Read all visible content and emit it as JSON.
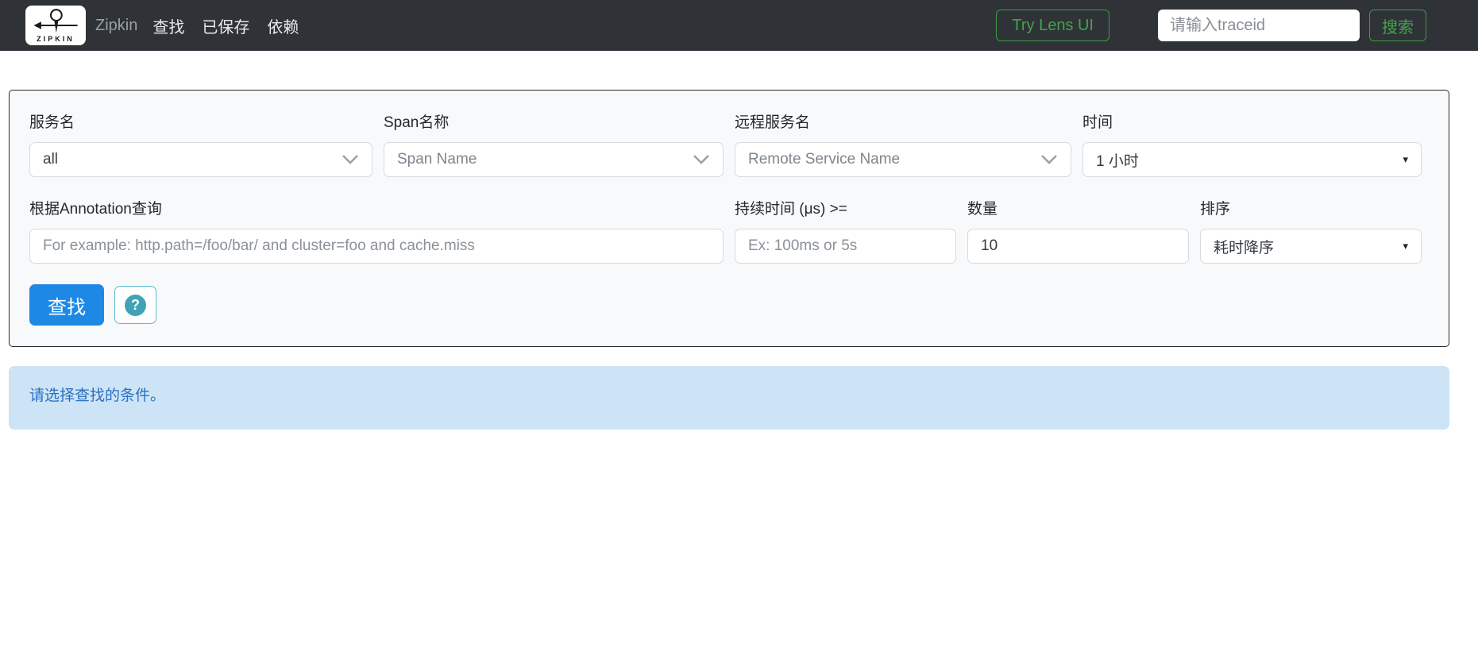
{
  "navbar": {
    "logo_text": "ZIPKIN",
    "brand": "Zipkin",
    "items": [
      {
        "label": "查找"
      },
      {
        "label": "已保存"
      },
      {
        "label": "依赖"
      }
    ],
    "try_lens_label": "Try Lens UI",
    "traceid_placeholder": "请输入traceid",
    "search_label": "搜索"
  },
  "form": {
    "service": {
      "label": "服务名",
      "value": "all"
    },
    "span": {
      "label": "Span名称",
      "value": "Span Name"
    },
    "remote": {
      "label": "远程服务名",
      "value": "Remote Service Name"
    },
    "lookback": {
      "label": "时间",
      "value": "1 小时",
      "arrow": "▾"
    },
    "annotation": {
      "label": "根据Annotation查询",
      "placeholder": "For example: http.path=/foo/bar/ and cluster=foo and cache.miss"
    },
    "duration": {
      "label": "持续时间 (μs) >=",
      "placeholder": "Ex: 100ms or 5s"
    },
    "limit": {
      "label": "数量",
      "value": "10"
    },
    "sort": {
      "label": "排序",
      "value": "耗时降序",
      "arrow": "▾"
    },
    "find_label": "查找",
    "help_glyph": "?"
  },
  "alert": {
    "message": "请选择查找的条件。"
  },
  "colors": {
    "navbar_bg": "#2f3338",
    "accent_green": "#41a447",
    "primary_blue": "#1e88e5",
    "help_teal": "#3fa3b5",
    "alert_bg": "#cde4f7",
    "alert_text": "#2a6fc0"
  }
}
